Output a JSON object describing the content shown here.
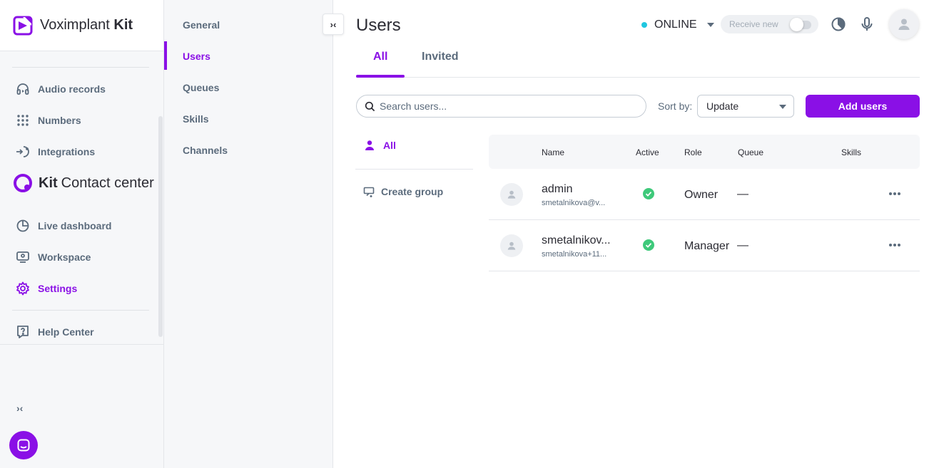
{
  "app": {
    "brand_word": "Voximplant",
    "brand_bold": "Kit"
  },
  "nav": {
    "items_top": [
      {
        "label": "Audio records",
        "icon": "headphones-icon"
      },
      {
        "label": "Numbers",
        "icon": "dialpad-icon"
      },
      {
        "label": "Integrations",
        "icon": "integrations-icon"
      }
    ],
    "section": {
      "bold": "Kit",
      "label": "Contact center",
      "icon": "kit-cc-logo-icon"
    },
    "items_cc": [
      {
        "label": "Live dashboard",
        "icon": "pie-chart-icon"
      },
      {
        "label": "Workspace",
        "icon": "workspace-icon"
      },
      {
        "label": "Settings",
        "icon": "gear-icon",
        "active": true
      }
    ],
    "help": {
      "label": "Help Center",
      "icon": "help-icon"
    },
    "collapse_glyph": "›‹"
  },
  "submenu": {
    "items": [
      "General",
      "Users",
      "Queues",
      "Skills",
      "Channels"
    ],
    "active": "Users",
    "toggle_glyph": "›‹"
  },
  "header": {
    "title": "Users",
    "status": "ONLINE",
    "status_color": "#1fc7e0",
    "receive_label": "Receive new"
  },
  "tabs": [
    {
      "label": "All",
      "active": true
    },
    {
      "label": "Invited",
      "active": false
    }
  ],
  "toolbar": {
    "search_placeholder": "Search users...",
    "sort_label": "Sort by:",
    "sort_value": "Update",
    "add_label": "Add users"
  },
  "groups": {
    "all_label": "All",
    "create_label": "Create group"
  },
  "table": {
    "columns": [
      "Name",
      "Active",
      "Role",
      "Queue",
      "Skills"
    ],
    "rows": [
      {
        "name": "admin",
        "email": "smetalnikova@v...",
        "active": true,
        "role": "Owner",
        "queue": "—"
      },
      {
        "name": "smetalnikov...",
        "email": "smetalnikova+11...",
        "active": true,
        "role": "Manager",
        "queue": "—"
      }
    ]
  },
  "colors": {
    "accent": "#8a10e6",
    "active_check": "#3ec97a",
    "text_muted": "#5b6b7c"
  }
}
